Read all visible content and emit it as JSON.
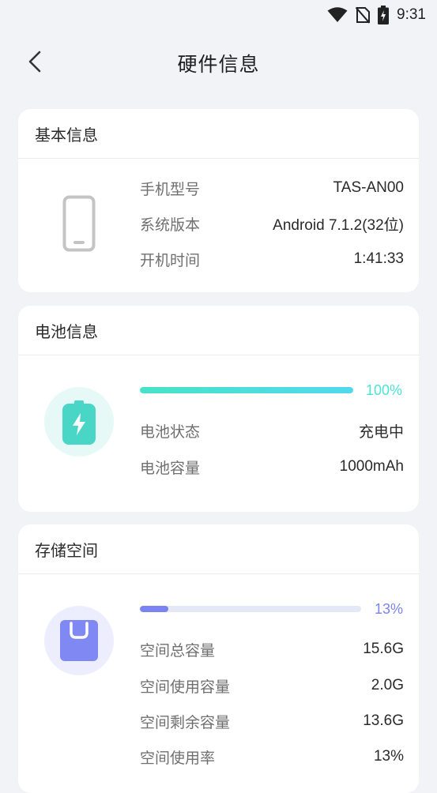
{
  "status_bar": {
    "time": "9:31",
    "icons": [
      "wifi-icon",
      "no-sim-icon",
      "battery-charging-icon"
    ]
  },
  "header": {
    "title": "硬件信息",
    "back_icon": "chevron-left-icon"
  },
  "basic_info": {
    "title": "基本信息",
    "icon": "phone-icon",
    "rows": [
      {
        "label": "手机型号",
        "value": "TAS-AN00"
      },
      {
        "label": "系统版本",
        "value": "Android 7.1.2(32位)"
      },
      {
        "label": "开机时间",
        "value": "1:41:33"
      }
    ]
  },
  "battery_info": {
    "title": "电池信息",
    "icon": "battery-bolt-icon",
    "progress": 100,
    "progress_text": "100%",
    "accent_color": "#4de3d1",
    "rows": [
      {
        "label": "电池状态",
        "value": "充电中"
      },
      {
        "label": "电池容量",
        "value": "1000mAh"
      }
    ]
  },
  "storage_info": {
    "title": "存储空间",
    "icon": "storage-card-icon",
    "progress": 13,
    "progress_text": "13%",
    "accent_color": "#7b83f2",
    "rows": [
      {
        "label": "空间总容量",
        "value": "15.6G"
      },
      {
        "label": "空间使用容量",
        "value": "2.0G"
      },
      {
        "label": "空间剩余容量",
        "value": "13.6G"
      },
      {
        "label": "空间使用率",
        "value": "13%"
      }
    ]
  }
}
